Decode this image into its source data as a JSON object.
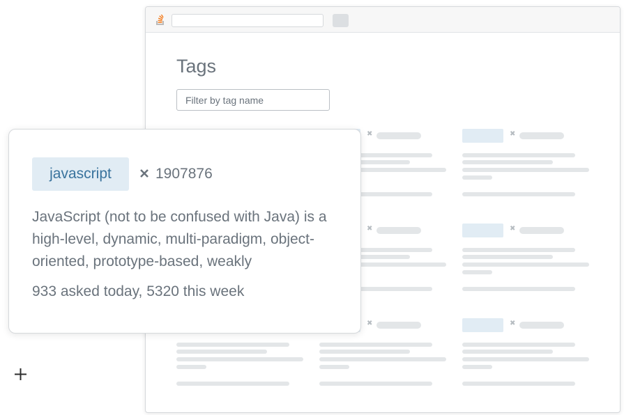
{
  "page": {
    "title": "Tags",
    "filter_placeholder": "Filter by tag name"
  },
  "popover": {
    "tag_name": "javascript",
    "close_icon": "x-icon",
    "question_count": "1907876",
    "excerpt": "JavaScript (not to be confused with Java) is a high-level, dynamic, multi-paradigm, object-oriented, prototype-based, weakly",
    "stats": "933 asked today, 5320 this week"
  },
  "icons": {
    "logo": "stack-overflow-logo-icon",
    "add": "plus-icon"
  },
  "colors": {
    "tag_bg": "#e1ecf4",
    "tag_text": "#39739d",
    "muted_text": "#6a737c",
    "accent_orange": "#f48024"
  }
}
